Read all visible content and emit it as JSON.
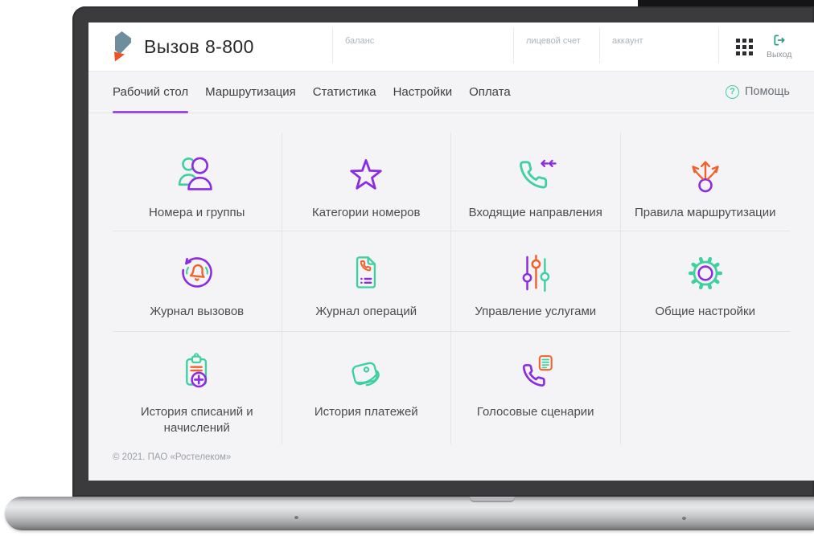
{
  "brand": {
    "title": "Вызов 8-800",
    "logo_icon": "rostelecom-flag-logo"
  },
  "topbar": {
    "labels": [
      "баланс",
      "лицевой счет",
      "аккаунт"
    ],
    "apps_icon": "apps-grid-icon",
    "logout_label": "Выход",
    "logout_icon": "logout-icon"
  },
  "nav": {
    "tabs": [
      "Рабочий стол",
      "Маршрутизация",
      "Статистика",
      "Настройки",
      "Оплата"
    ],
    "active_index": 0,
    "help_label": "Помощь",
    "help_icon": "question-circle-icon"
  },
  "tiles": [
    {
      "label": "Номера и группы",
      "icon": "users-icon"
    },
    {
      "label": "Категории номеров",
      "icon": "star-icon"
    },
    {
      "label": "Входящие направления",
      "icon": "incoming-call-icon"
    },
    {
      "label": "Правила маршрутизации",
      "icon": "routing-arrows-icon"
    },
    {
      "label": "Журнал вызовов",
      "icon": "call-log-icon"
    },
    {
      "label": "Журнал операций",
      "icon": "operations-log-icon"
    },
    {
      "label": "Управление услугами",
      "icon": "sliders-icon"
    },
    {
      "label": "Общие настройки",
      "icon": "gear-icon"
    },
    {
      "label": "История списаний и начислений",
      "icon": "charges-history-icon"
    },
    {
      "label": "История платежей",
      "icon": "wallet-icon"
    },
    {
      "label": "Голосовые сценарии",
      "icon": "voice-scripts-icon"
    }
  ],
  "footer": {
    "copyright": "© 2021. ПАО «Ростелеком»"
  },
  "colors": {
    "accent_purple": "#8b2be2",
    "accent_teal": "#3fd0a0",
    "accent_orange": "#f2612d",
    "tab_underline": "#9b4ede",
    "logo_slate": "#6f8e9d",
    "logo_orange": "#f05123",
    "screen_bg": "#f4f4f6"
  }
}
